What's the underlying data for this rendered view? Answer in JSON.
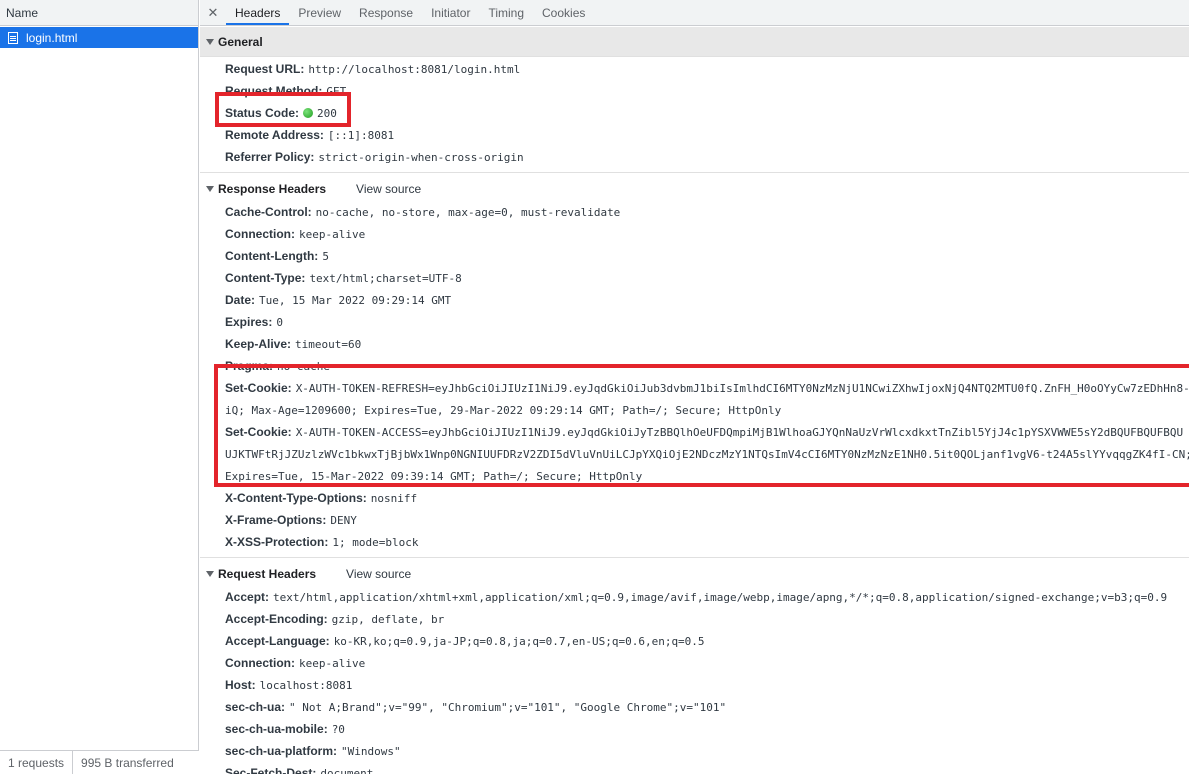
{
  "left_panel": {
    "column_header": "Name",
    "requests": [
      {
        "name": "login.html"
      }
    ],
    "status": {
      "requests": "1 requests",
      "transferred": "995 B transferred"
    }
  },
  "tabs": {
    "close_icon": "close-icon",
    "items": [
      "Headers",
      "Preview",
      "Response",
      "Initiator",
      "Timing",
      "Cookies"
    ],
    "active": "Headers"
  },
  "general": {
    "title": "General",
    "rows": [
      {
        "key": "Request URL:",
        "value": "http://localhost:8081/login.html"
      },
      {
        "key": "Request Method:",
        "value": "GET"
      },
      {
        "key": "Status Code:",
        "value": "200",
        "status_color": "#1f9c1f"
      },
      {
        "key": "Remote Address:",
        "value": "[::1]:8081"
      },
      {
        "key": "Referrer Policy:",
        "value": "strict-origin-when-cross-origin"
      }
    ]
  },
  "response_headers": {
    "title": "Response Headers",
    "view_source": "View source",
    "rows": [
      {
        "key": "Cache-Control:",
        "value": "no-cache, no-store, max-age=0, must-revalidate"
      },
      {
        "key": "Connection:",
        "value": "keep-alive"
      },
      {
        "key": "Content-Length:",
        "value": "5"
      },
      {
        "key": "Content-Type:",
        "value": "text/html;charset=UTF-8"
      },
      {
        "key": "Date:",
        "value": "Tue, 15 Mar 2022 09:29:14 GMT"
      },
      {
        "key": "Expires:",
        "value": "0"
      },
      {
        "key": "Keep-Alive:",
        "value": "timeout=60"
      },
      {
        "key": "Pragma:",
        "value": "no-cache"
      },
      {
        "key": "Set-Cookie:",
        "value": "X-AUTH-TOKEN-REFRESH=eyJhbGciOiJIUzI1NiJ9.eyJqdGkiOiJub3dvbmJ1biIsImlhdCI6MTY0NzMzNjU1NCwiZXhwIjoxNjQ4NTQ2MTU0fQ.ZnFH_H0oOYyCw7zEDhHn8-",
        "cont": "iQ; Max-Age=1209600; Expires=Tue, 29-Mar-2022 09:29:14 GMT; Path=/; Secure; HttpOnly"
      },
      {
        "key": "Set-Cookie:",
        "value": "X-AUTH-TOKEN-ACCESS=eyJhbGciOiJIUzI1NiJ9.eyJqdGkiOiJyTzBBQlhOeUFDQmpiMjB1WlhoaGJYQnNaUzVrWlcxdkxtTnZibl5YjJ4c1pYSXVWWE5sY2dBQUFBQUFBQU",
        "cont": "UJKTWFtRjJZUzlzWVc1bkwxTjBjbWx1Wnp0NGNIUUFDRzV2ZDI5dVluVnUiLCJpYXQiOjE2NDczMzY1NTQsImV4cCI6MTY0NzMzNzE1NH0.5it0QOLjanf1vgV6-t24A5slYYvqqgZK4fI-CN;",
        "cont2": "Expires=Tue, 15-Mar-2022 09:39:14 GMT; Path=/; Secure; HttpOnly"
      },
      {
        "key": "X-Content-Type-Options:",
        "value": "nosniff"
      },
      {
        "key": "X-Frame-Options:",
        "value": "DENY"
      },
      {
        "key": "X-XSS-Protection:",
        "value": "1; mode=block"
      }
    ]
  },
  "request_headers": {
    "title": "Request Headers",
    "view_source": "View source",
    "rows": [
      {
        "key": "Accept:",
        "value": "text/html,application/xhtml+xml,application/xml;q=0.9,image/avif,image/webp,image/apng,*/*;q=0.8,application/signed-exchange;v=b3;q=0.9"
      },
      {
        "key": "Accept-Encoding:",
        "value": "gzip, deflate, br"
      },
      {
        "key": "Accept-Language:",
        "value": "ko-KR,ko;q=0.9,ja-JP;q=0.8,ja;q=0.7,en-US;q=0.6,en;q=0.5"
      },
      {
        "key": "Connection:",
        "value": "keep-alive"
      },
      {
        "key": "Host:",
        "value": "localhost:8081"
      },
      {
        "key": "sec-ch-ua:",
        "value": "\" Not A;Brand\";v=\"99\", \"Chromium\";v=\"101\", \"Google Chrome\";v=\"101\""
      },
      {
        "key": "sec-ch-ua-mobile:",
        "value": "?0"
      },
      {
        "key": "sec-ch-ua-platform:",
        "value": "\"Windows\""
      },
      {
        "key": "Sec-Fetch-Dest:",
        "value": "document"
      }
    ]
  },
  "highlight_color": "#e3242b"
}
